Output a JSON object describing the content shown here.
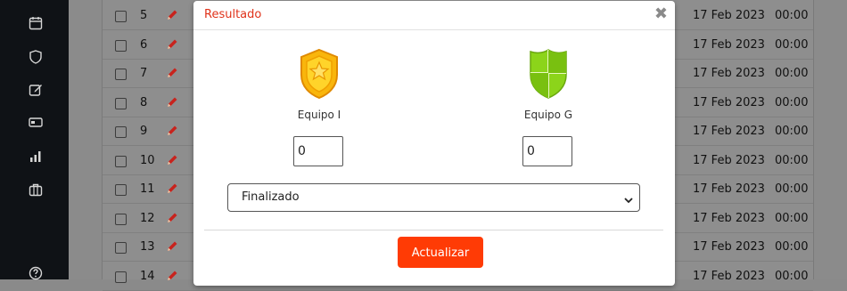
{
  "sidebar": {
    "items": [
      {
        "icon": "calendar-icon"
      },
      {
        "icon": "shield-icon"
      },
      {
        "icon": "edit-icon"
      },
      {
        "icon": "ticket-icon"
      },
      {
        "icon": "bar-chart-icon"
      },
      {
        "icon": "briefcase-icon"
      },
      {
        "icon": "help-icon"
      }
    ]
  },
  "table": {
    "rows": [
      {
        "num": "5",
        "date": "17 Feb 2023",
        "time": "00:00"
      },
      {
        "num": "6",
        "date": "17 Feb 2023",
        "time": "00:00"
      },
      {
        "num": "7",
        "date": "17 Feb 2023",
        "time": "00:00"
      },
      {
        "num": "8",
        "date": "17 Feb 2023",
        "time": "00:00"
      },
      {
        "num": "9",
        "date": "17 Feb 2023",
        "time": "00:00"
      },
      {
        "num": "10",
        "date": "17 Feb 2023",
        "time": "00:00"
      },
      {
        "num": "11",
        "date": "17 Feb 2023",
        "time": "00:00"
      },
      {
        "num": "12",
        "date": "17 Feb 2023",
        "time": "00:00"
      },
      {
        "num": "13",
        "date": "17 Feb 2023",
        "time": "00:00"
      },
      {
        "num": "14",
        "date": "17 Feb 2023",
        "time": "00:00"
      }
    ]
  },
  "modal": {
    "title": "Resultado",
    "close_label": "✖",
    "home_team": {
      "name": "Equipo I",
      "score": "0",
      "color": "#f5c518"
    },
    "away_team": {
      "name": "Equipo G",
      "score": "0",
      "color": "#8cd41a"
    },
    "status_value": "Finalizado",
    "update_label": "Actualizar"
  },
  "colors": {
    "accent": "#ff3b05",
    "title": "#e0321a",
    "sidebar": "#0f1216"
  }
}
